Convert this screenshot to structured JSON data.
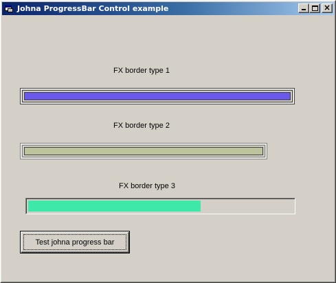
{
  "window": {
    "title": "Johna ProgressBar Control example",
    "controls": {
      "minimize": "minimize-icon",
      "maximize": "maximize-icon",
      "close_glyph": "×"
    }
  },
  "progress_bars": [
    {
      "label": "FX border  type 1",
      "value_percent": 100,
      "fill_color": "#6a5aec"
    },
    {
      "label": "FX border  type 2",
      "value_percent": 100,
      "fill_color": "#bdc49c"
    },
    {
      "label": "FX border  type 3",
      "value_percent": 65,
      "fill_color": "#3ee8a8"
    }
  ],
  "test_button": {
    "label": "Test johna progress bar"
  },
  "colors": {
    "window_face": "#d4d0c8",
    "titlebar_start": "#0a246a",
    "titlebar_end": "#a6caf0"
  }
}
